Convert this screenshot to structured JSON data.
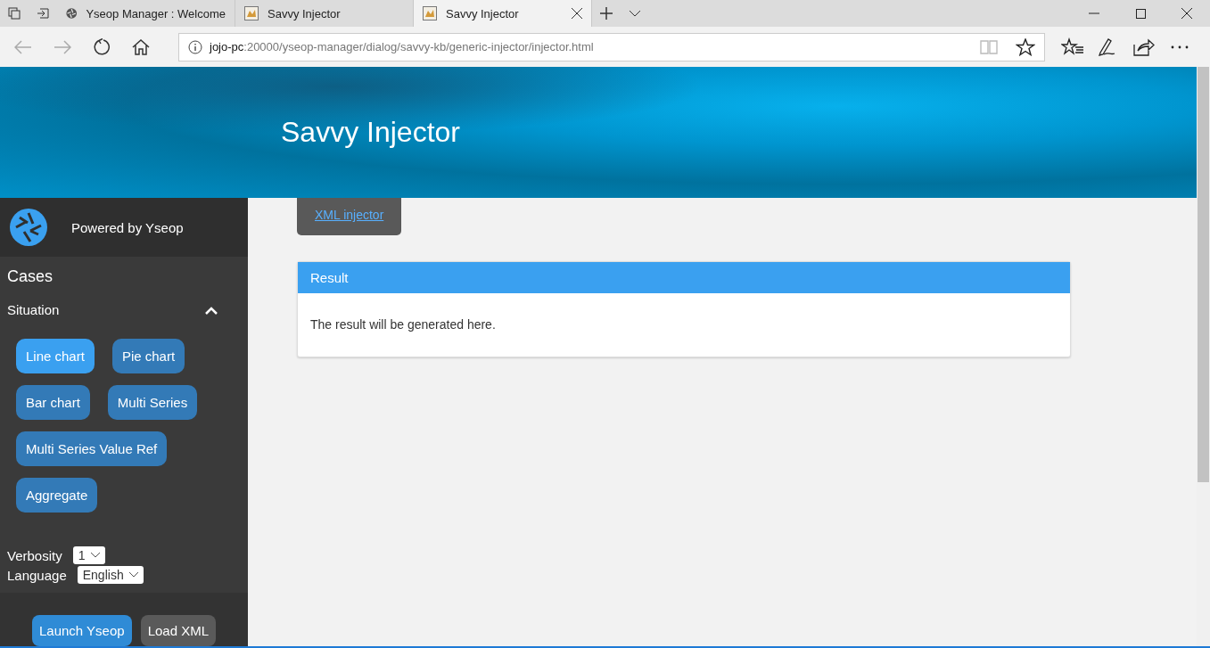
{
  "browser": {
    "tabs": [
      {
        "title": "Yseop Manager : Welcome",
        "kind": "logo",
        "selected": false
      },
      {
        "title": "Savvy Injector",
        "kind": "page",
        "selected": false
      },
      {
        "title": "Savvy Injector",
        "kind": "page",
        "selected": true
      }
    ],
    "address": {
      "host": "jojo-pc",
      "path": ":20000/yseop-manager/dialog/savvy-kb/generic-injector/injector.html"
    }
  },
  "header": {
    "title": "Savvy Injector"
  },
  "sidebar": {
    "powered_by": "Powered by Yseop",
    "cases_heading": "Cases",
    "section": {
      "title": "Situation",
      "expanded": true
    },
    "cases": [
      {
        "label": "Line chart",
        "selected": true
      },
      {
        "label": "Pie chart",
        "selected": false
      },
      {
        "label": "Bar chart",
        "selected": false
      },
      {
        "label": "Multi Series",
        "selected": false
      },
      {
        "label": "Multi Series Value Ref",
        "selected": false
      },
      {
        "label": "Aggregate",
        "selected": false
      }
    ],
    "verbosity": {
      "label": "Verbosity",
      "value": "1"
    },
    "language": {
      "label": "Language",
      "value": "English"
    },
    "buttons": [
      {
        "label": "Launch Yseop",
        "kind": "primary"
      },
      {
        "label": "Load XML",
        "kind": "secondary"
      }
    ]
  },
  "main": {
    "tab": {
      "label": "XML injector"
    },
    "result": {
      "title": "Result",
      "body": "The result will be generated here."
    }
  }
}
